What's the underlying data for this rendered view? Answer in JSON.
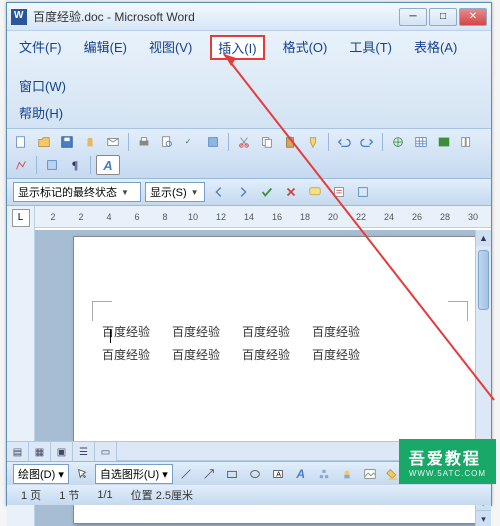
{
  "title": "百度经验.doc - Microsoft Word",
  "menu": {
    "file": "文件(F)",
    "edit": "编辑(E)",
    "view": "视图(V)",
    "insert": "插入(I)",
    "format": "格式(O)",
    "tools": "工具(T)",
    "table": "表格(A)",
    "window": "窗口(W)",
    "help": "帮助(H)"
  },
  "toolbar2": {
    "track_label": "显示标记的最终状态",
    "show_label": "显示(S)"
  },
  "ruler_ticks": [
    "2",
    "",
    "2",
    "4",
    "6",
    "8",
    "10",
    "12",
    "14",
    "16",
    "18",
    "20",
    "22",
    "24",
    "26",
    "28",
    "30"
  ],
  "document": {
    "cells": [
      "百度经验",
      "百度经验",
      "百度经验",
      "百度经验",
      "百度经验",
      "百度经验",
      "百度经验",
      "百度经验"
    ]
  },
  "drawbar": {
    "draw_label": "绘图(D)",
    "autoshape_label": "自选图形(U)"
  },
  "status": {
    "page": "1 页",
    "section": "1 节",
    "pageof": "1/1",
    "position": "位置 2.5厘米"
  },
  "watermark": {
    "main": "吾爱教程",
    "sub": "WWW.5ATC.COM"
  },
  "icons": {
    "min": "─",
    "max": "□",
    "close": "✕"
  }
}
